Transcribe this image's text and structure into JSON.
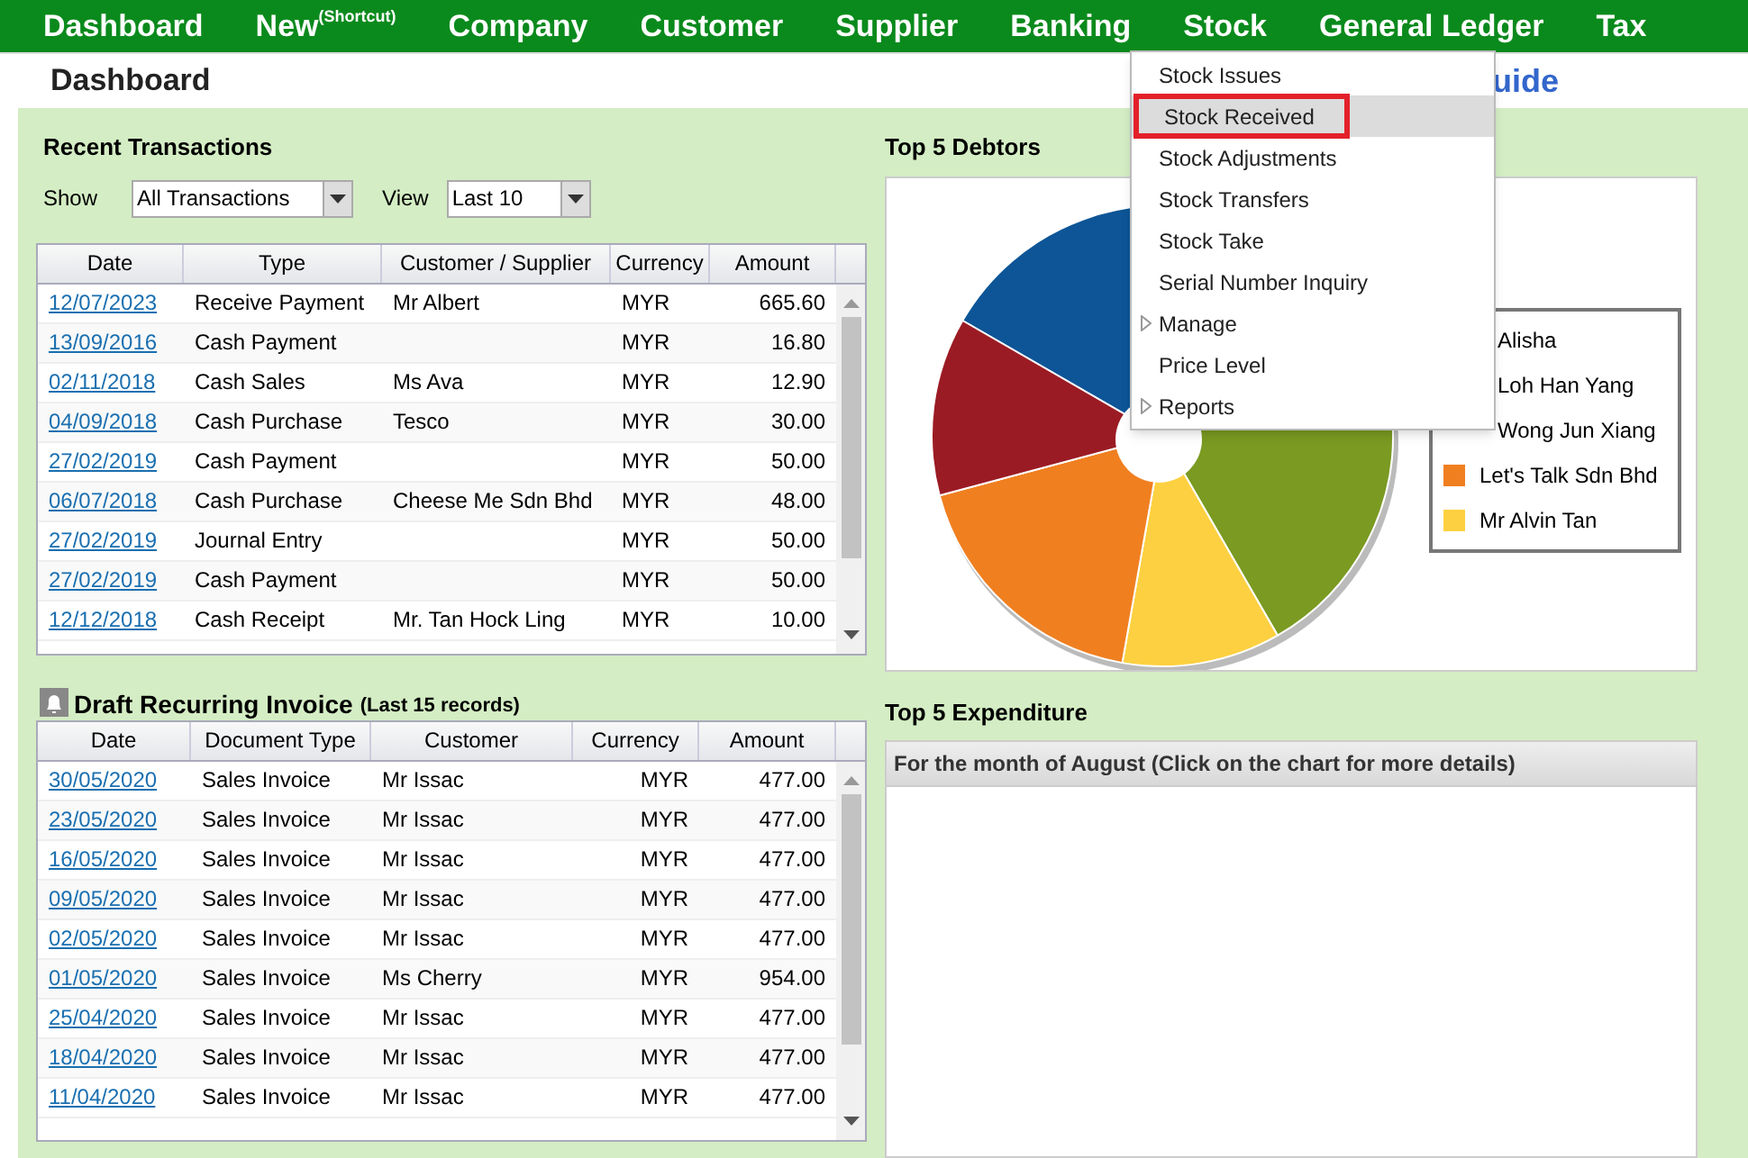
{
  "nav": [
    {
      "label": "Dashboard"
    },
    {
      "label": "New$^{(Shortcut)}$"
    },
    {
      "label": "Company"
    },
    {
      "label": "Customer"
    },
    {
      "label": "Supplier"
    },
    {
      "label": "Banking"
    },
    {
      "label": "Stock"
    },
    {
      "label": "General Ledger"
    },
    {
      "label": "Tax"
    }
  ],
  "page_title": "Dashboard",
  "guide_link": "uide",
  "recent": {
    "title": "Recent Transactions",
    "show_label": "Show",
    "show_value": "All Transactions",
    "view_label": "View",
    "view_value": "Last 10",
    "columns": [
      "Date",
      "Type",
      "Customer / Supplier",
      "Currency",
      "Amount"
    ],
    "rows": [
      [
        "12/07/2023",
        "Receive Payment",
        "Mr Albert",
        "MYR",
        "665.60"
      ],
      [
        "13/09/2016",
        "Cash Payment",
        "",
        "MYR",
        "16.80"
      ],
      [
        "02/11/2018",
        "Cash Sales",
        "Ms Ava",
        "MYR",
        "12.90"
      ],
      [
        "04/09/2018",
        "Cash Purchase",
        "Tesco",
        "MYR",
        "30.00"
      ],
      [
        "27/02/2019",
        "Cash Payment",
        "",
        "MYR",
        "50.00"
      ],
      [
        "06/07/2018",
        "Cash Purchase",
        "Cheese Me Sdn Bhd",
        "MYR",
        "48.00"
      ],
      [
        "27/02/2019",
        "Journal Entry",
        "",
        "MYR",
        "50.00"
      ],
      [
        "27/02/2019",
        "Cash Payment",
        "",
        "MYR",
        "50.00"
      ],
      [
        "12/12/2018",
        "Cash Receipt",
        "Mr. Tan Hock Ling",
        "MYR",
        "10.00"
      ]
    ]
  },
  "draft": {
    "title": "Draft Recurring Invoice",
    "subtitle": "(Last 15 records)",
    "columns": [
      "Date",
      "Document Type",
      "Customer",
      "Currency",
      "Amount"
    ],
    "rows": [
      [
        "30/05/2020",
        "Sales Invoice",
        "Mr Issac",
        "MYR",
        "477.00"
      ],
      [
        "23/05/2020",
        "Sales Invoice",
        "Mr Issac",
        "MYR",
        "477.00"
      ],
      [
        "16/05/2020",
        "Sales Invoice",
        "Mr Issac",
        "MYR",
        "477.00"
      ],
      [
        "09/05/2020",
        "Sales Invoice",
        "Mr Issac",
        "MYR",
        "477.00"
      ],
      [
        "02/05/2020",
        "Sales Invoice",
        "Mr Issac",
        "MYR",
        "477.00"
      ],
      [
        "01/05/2020",
        "Sales Invoice",
        "Ms Cherry",
        "MYR",
        "954.00"
      ],
      [
        "25/04/2020",
        "Sales Invoice",
        "Mr Issac",
        "MYR",
        "477.00"
      ],
      [
        "18/04/2020",
        "Sales Invoice",
        "Mr Issac",
        "MYR",
        "477.00"
      ],
      [
        "11/04/2020",
        "Sales Invoice",
        "Mr Issac",
        "MYR",
        "477.00"
      ]
    ]
  },
  "debtors": {
    "title": "Top 5 Debtors",
    "legend": [
      {
        "label": "Alisha",
        "covered": true
      },
      {
        "label": "Loh Han Yang",
        "covered": true
      },
      {
        "label": "Wong Jun Xiang",
        "covered": true
      },
      {
        "label": "Let's Talk Sdn Bhd",
        "color": "#f07f20"
      },
      {
        "label": "Mr Alvin Tan",
        "color": "#fdd041"
      }
    ]
  },
  "expenditure": {
    "title": "Top 5 Expenditure",
    "header": "For the month of August (Click on the chart for more details)"
  },
  "stock_menu": [
    {
      "label": "Stock Issues",
      "selected": false,
      "submenu": false
    },
    {
      "label": "Stock Received",
      "selected": true,
      "submenu": false
    },
    {
      "label": "Stock Adjustments",
      "selected": false,
      "submenu": false
    },
    {
      "label": "Stock Transfers",
      "selected": false,
      "submenu": false
    },
    {
      "label": "Stock Take",
      "selected": false,
      "submenu": false
    },
    {
      "label": "Serial Number Inquiry",
      "selected": false,
      "submenu": false
    },
    {
      "label": "Manage",
      "selected": false,
      "submenu": true
    },
    {
      "label": "Price Level",
      "selected": false,
      "submenu": false
    },
    {
      "label": "Reports",
      "selected": false,
      "submenu": true
    }
  ]
}
